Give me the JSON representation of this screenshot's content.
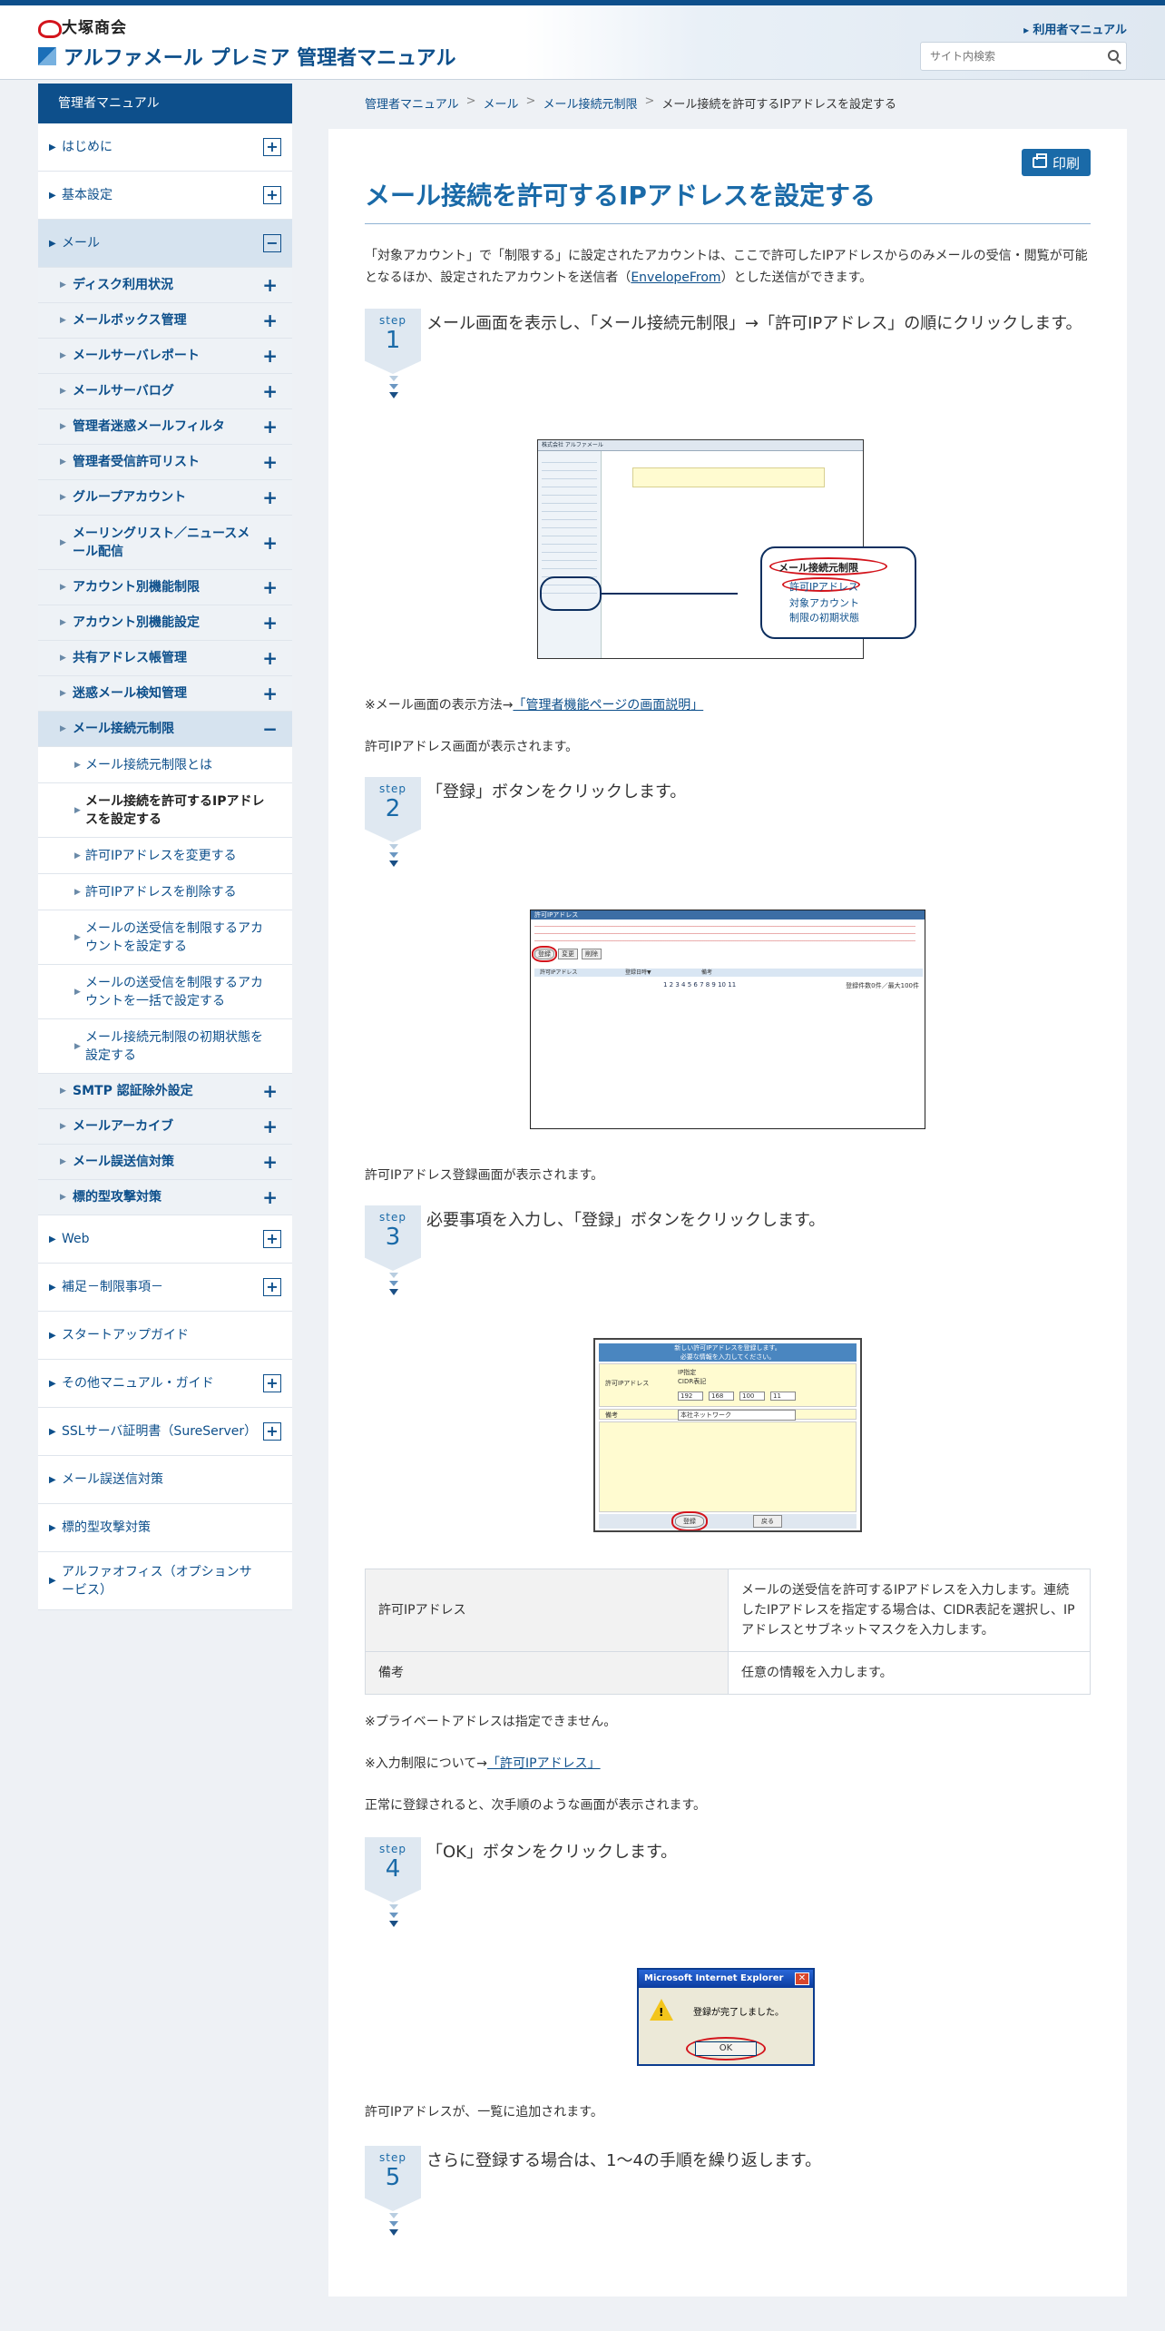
{
  "header": {
    "company_name": "大塚商会",
    "site_title": "アルファメール プレミア 管理者マニュアル",
    "user_link": "利用者マニュアル",
    "search_placeholder": "サイト内検索"
  },
  "sidebar": {
    "heading": "管理者マニュアル",
    "items": [
      {
        "label": "はじめに",
        "toggle": "+"
      },
      {
        "label": "基本設定",
        "toggle": "+"
      },
      {
        "label": "メール",
        "toggle": "−"
      },
      {
        "label": "ディスク利用状況",
        "toggle": "+"
      },
      {
        "label": "メールボックス管理",
        "toggle": "+"
      },
      {
        "label": "メールサーバレポート",
        "toggle": "+"
      },
      {
        "label": "メールサーバログ",
        "toggle": "+"
      },
      {
        "label": "管理者迷惑メールフィルタ",
        "toggle": "+"
      },
      {
        "label": "管理者受信許可リスト",
        "toggle": "+"
      },
      {
        "label": "グループアカウント",
        "toggle": "+"
      },
      {
        "label": "メーリングリスト／ニュースメール配信",
        "toggle": "+"
      },
      {
        "label": "アカウント別機能制限",
        "toggle": "+"
      },
      {
        "label": "アカウント別機能設定",
        "toggle": "+"
      },
      {
        "label": "共有アドレス帳管理",
        "toggle": "+"
      },
      {
        "label": "迷惑メール検知管理",
        "toggle": "+"
      },
      {
        "label": "メール接続元制限",
        "toggle": "−"
      },
      {
        "label": "メール接続元制限とは"
      },
      {
        "label": "メール接続を許可するIPアドレスを設定する"
      },
      {
        "label": "許可IPアドレスを変更する"
      },
      {
        "label": "許可IPアドレスを削除する"
      },
      {
        "label": "メールの送受信を制限するアカウントを設定する"
      },
      {
        "label": "メールの送受信を制限するアカウントを一括で設定する"
      },
      {
        "label": "メール接続元制限の初期状態を設定する"
      },
      {
        "label": "SMTP 認証除外設定",
        "toggle": "+"
      },
      {
        "label": "メールアーカイブ",
        "toggle": "+"
      },
      {
        "label": "メール誤送信対策",
        "toggle": "+"
      },
      {
        "label": "標的型攻撃対策",
        "toggle": "+"
      },
      {
        "label": "Web",
        "toggle": "+"
      },
      {
        "label": "補足－制限事項－",
        "toggle": "+"
      },
      {
        "label": "スタートアップガイド"
      },
      {
        "label": "その他マニュアル・ガイド",
        "toggle": "+"
      },
      {
        "label": "SSLサーバ証明書（SureServer）",
        "toggle": "+"
      },
      {
        "label": "メール誤送信対策"
      },
      {
        "label": "標的型攻撃対策"
      },
      {
        "label": "アルファオフィス（オプションサービス）"
      }
    ]
  },
  "breadcrumb": [
    "管理者マニュアル",
    "メール",
    "メール接続元制限",
    "メール接続を許可するIPアドレスを設定する"
  ],
  "breadcrumb_sep": ">",
  "main": {
    "print_label": "印刷",
    "title": "メール接続を許可するIPアドレスを設定する",
    "intro_before": "「対象アカウント」で「制限する」に設定されたアカウントは、ここで許可したIPアドレスからのみメールの受信・閲覧が可能となるほか、設定されたアカウントを送信者（",
    "intro_link": "EnvelopeFrom",
    "intro_after": "）とした送信ができます。",
    "step_word": "step",
    "steps": [
      {
        "num": "1",
        "text": "メール画面を表示し、「メール接続元制限」→「許可IPアドレス」の順にクリックします。"
      },
      {
        "num": "2",
        "text": "「登録」ボタンをクリックします。"
      },
      {
        "num": "3",
        "text": "必要事項を入力し、「登録」ボタンをクリックします。"
      },
      {
        "num": "4",
        "text": "「OK」ボタンをクリックします。"
      },
      {
        "num": "5",
        "text": "さらに登録する場合は、1～4の手順を繰り返します。"
      }
    ],
    "note1_before": "※メール画面の表示方法→",
    "note1_link": "「管理者機能ページの画面説明」",
    "after1": "許可IPアドレス画面が表示されます。",
    "after2": "許可IPアドレス登録画面が表示されます。",
    "table": [
      {
        "key": "許可IPアドレス",
        "value": "メールの送受信を許可するIPアドレスを入力します。連続したIPアドレスを指定する場合は、CIDR表記を選択し、IPアドレスとサブネットマスクを入力します。"
      },
      {
        "key": "備考",
        "value": "任意の情報を入力します。"
      }
    ],
    "note2": "※プライベートアドレスは指定できません。",
    "note3_before": "※入力制限について→",
    "note3_link": "「許可IPアドレス」",
    "after3": "正常に登録されると、次手順のような画面が表示されます。",
    "after4": "許可IPアドレスが、一覧に追加されます。",
    "shot1": {
      "callout_title": "メール接続元制限",
      "callout_item1": "許可IPアドレス",
      "callout_item2": "対象アカウント",
      "callout_item3": "制限の初期状態",
      "header": "株式会社 アルファメール"
    },
    "shot2": {
      "title": "許可IPアドレス",
      "btn_register": "登録",
      "btn_change": "変更",
      "btn_delete": "削除",
      "col1": "許可IPアドレス",
      "col2": "登録日時▼",
      "col3": "備考",
      "pager": "1 2 3 4 5 6 7 8 9 10 11",
      "count": "登録件数0件／最大100件"
    },
    "shot3": {
      "head1": "新しい許可IPアドレスを登録します。",
      "head2": "必要な情報を入力してください。",
      "label_ip": "許可IPアドレス",
      "opt1": "IP指定",
      "opt2": "CIDR表記",
      "ip": [
        "192",
        "168",
        "100",
        "11"
      ],
      "label_note": "備考",
      "note_value": "本社ネットワーク",
      "btn_register": "登録",
      "btn_back": "戻る"
    },
    "shot4": {
      "title": "Microsoft Internet Explorer",
      "message": "登録が完了しました。",
      "ok": "OK"
    }
  },
  "colors": {
    "brand": "#0d4f8b",
    "accent": "#1a6aa8",
    "highlight_red": "#d3141c"
  }
}
